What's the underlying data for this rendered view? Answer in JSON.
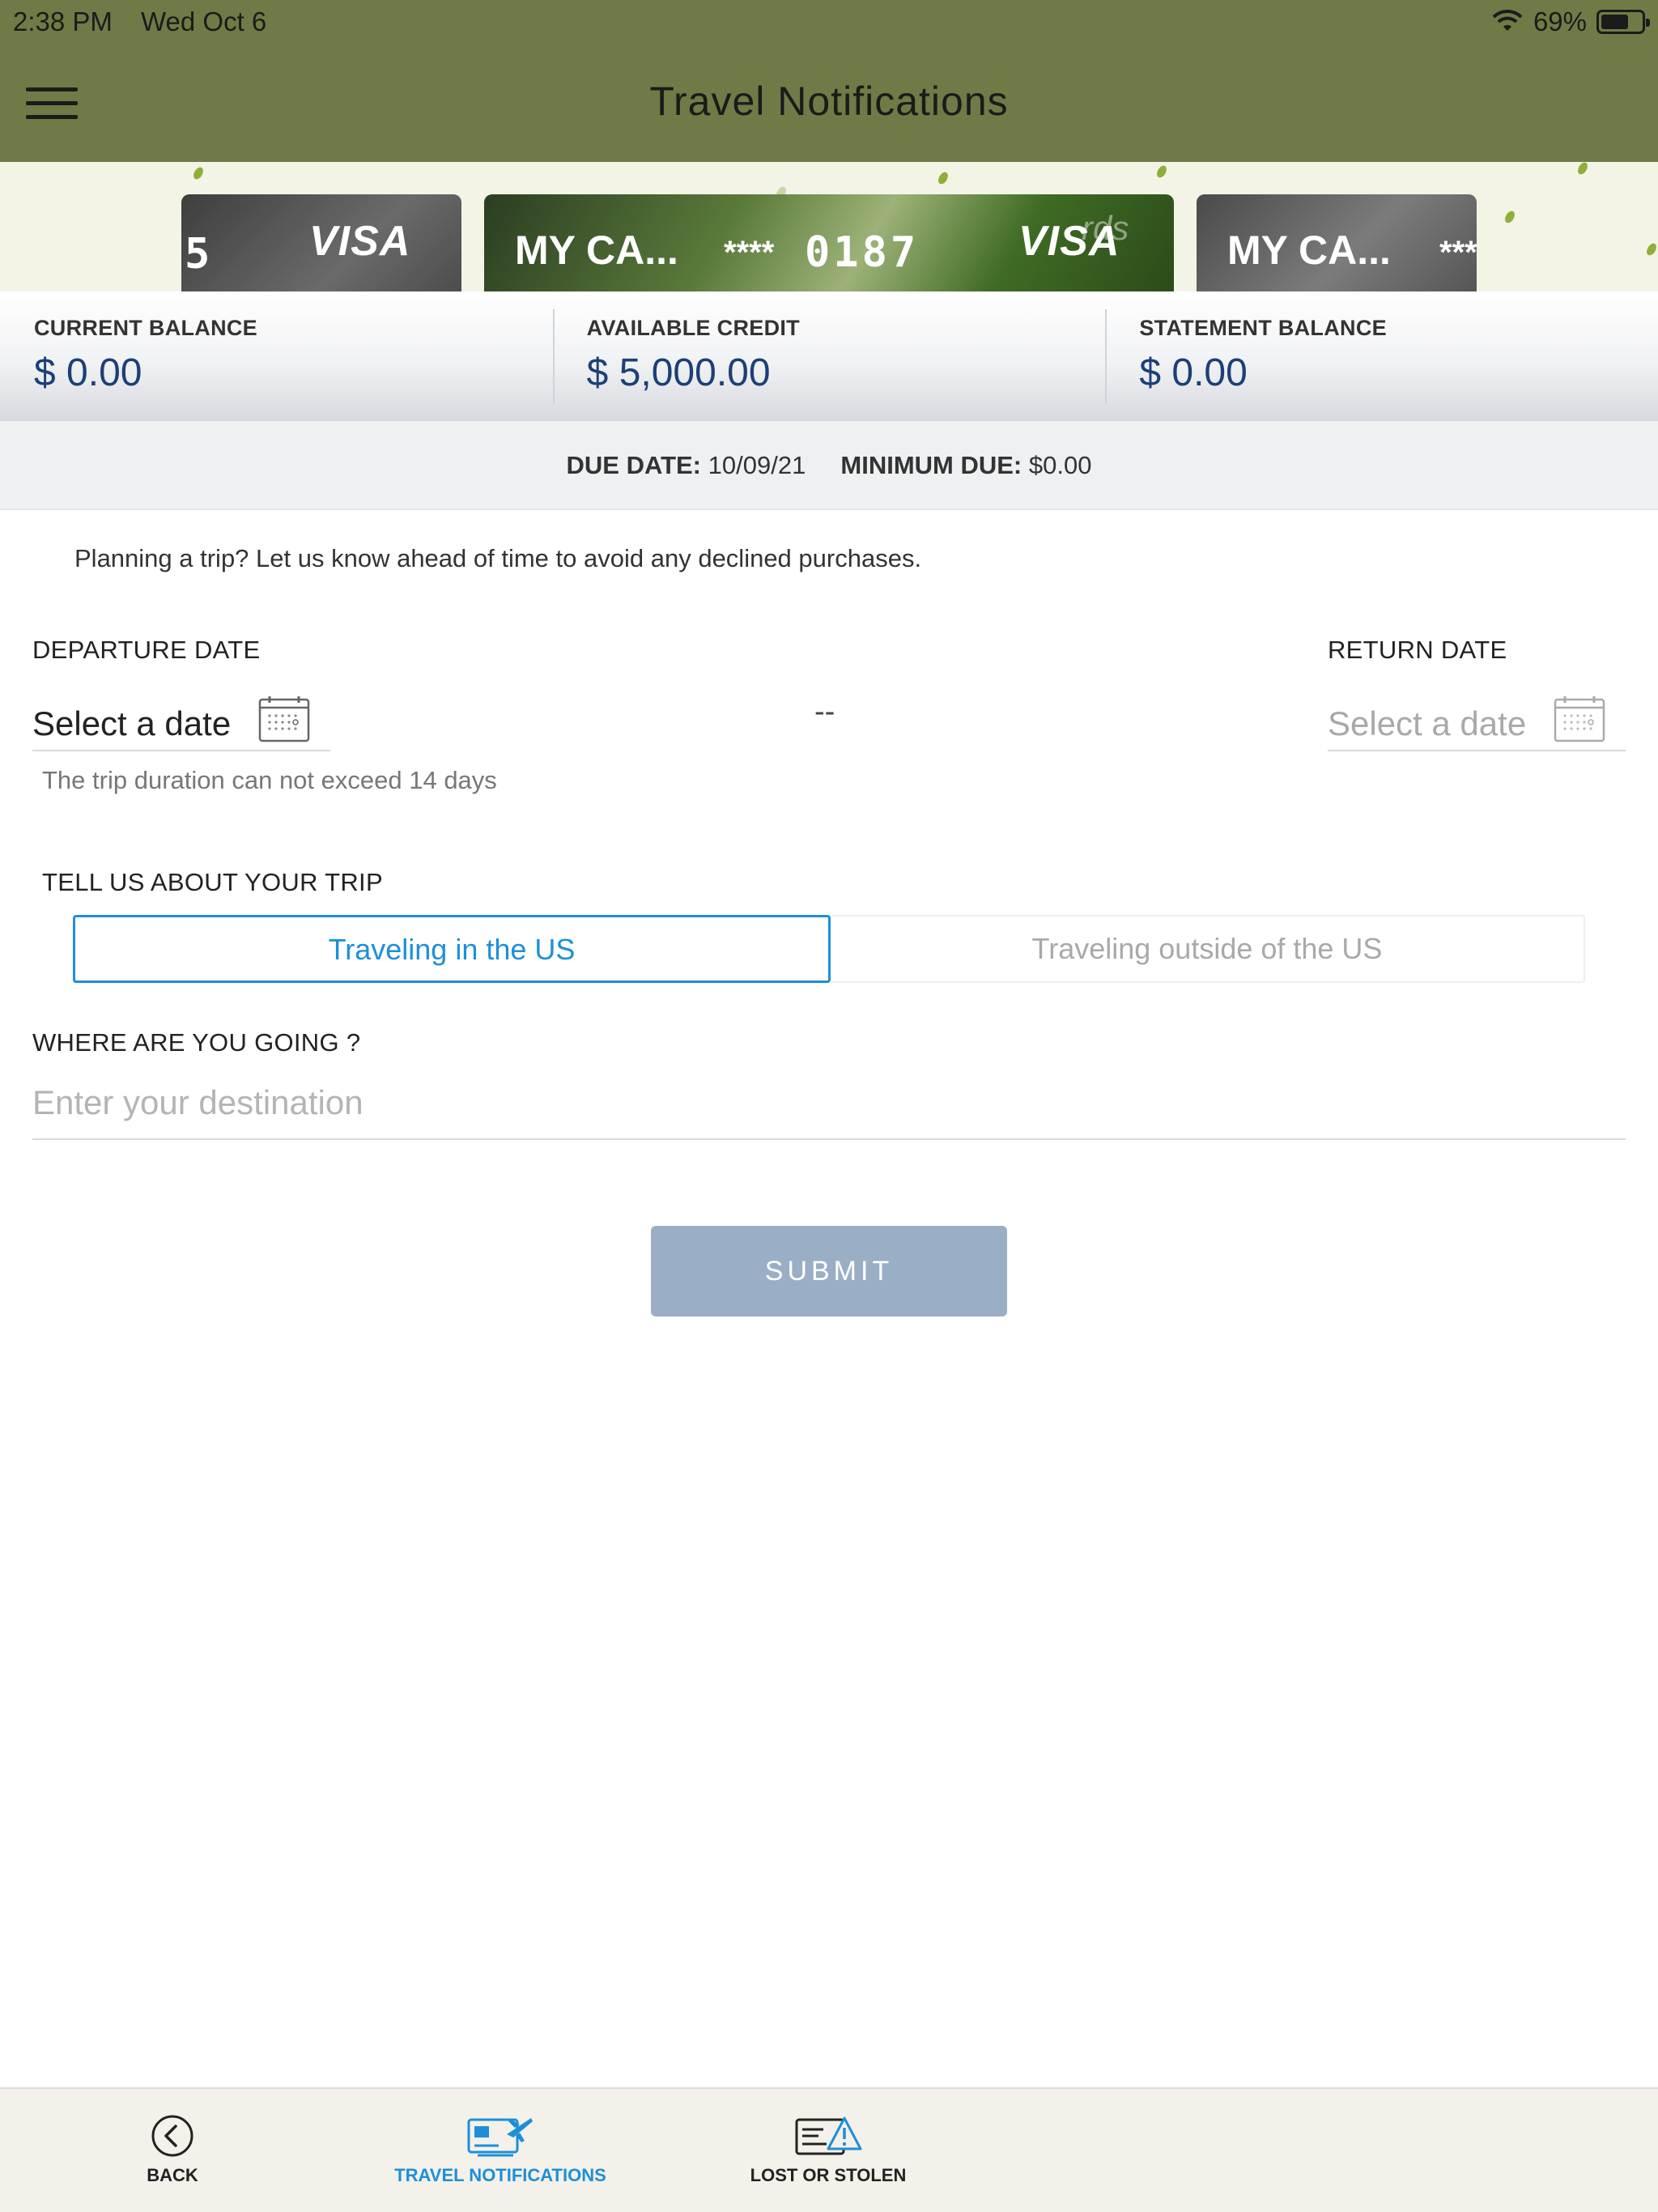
{
  "status_bar": {
    "time": "2:38 PM",
    "date": "Wed Oct 6",
    "battery": "69%",
    "battery_level": 0.69
  },
  "header": {
    "title": "Travel Notifications"
  },
  "cards": [
    {
      "name_label": "",
      "number": "5",
      "brand": "VISA"
    },
    {
      "name_label": "MY CA...",
      "masked": "****",
      "number": "0187",
      "brand": "VISA",
      "overlay": "rds"
    },
    {
      "name_label": "MY CA...",
      "masked": "***",
      "number": "",
      "brand": ""
    }
  ],
  "balances": {
    "current": {
      "label": "CURRENT BALANCE",
      "value": "$ 0.00"
    },
    "available": {
      "label": "AVAILABLE CREDIT",
      "value": "$ 5,000.00"
    },
    "statement": {
      "label": "STATEMENT BALANCE",
      "value": "$ 0.00"
    }
  },
  "due": {
    "due_label": "DUE DATE:",
    "due_value": "10/09/21",
    "min_label": "MINIMUM DUE:",
    "min_value": "$0.00"
  },
  "form": {
    "intro": "Planning a trip? Let us know ahead of time to avoid any declined purchases.",
    "departure_label": "DEPARTURE DATE",
    "departure_value": "Select a date",
    "return_label": "RETURN DATE",
    "return_value": "Select a date",
    "separator": "--",
    "duration_hint": "The trip duration can not exceed 14 days",
    "trip_label": "TELL US ABOUT YOUR TRIP",
    "trip_options": [
      "Traveling in the US",
      "Traveling outside of the US"
    ],
    "destination_label": "WHERE ARE YOU GOING ?",
    "destination_placeholder": "Enter your destination",
    "submit": "SUBMIT"
  },
  "tabbar": {
    "back": "BACK",
    "travel": "TRAVEL NOTIFICATIONS",
    "lost": "LOST OR STOLEN"
  },
  "colors": {
    "header": "#6f7b46",
    "accent": "#1d8fd8",
    "value_text": "#1c3f77",
    "submit_disabled": "#9aafc6"
  }
}
